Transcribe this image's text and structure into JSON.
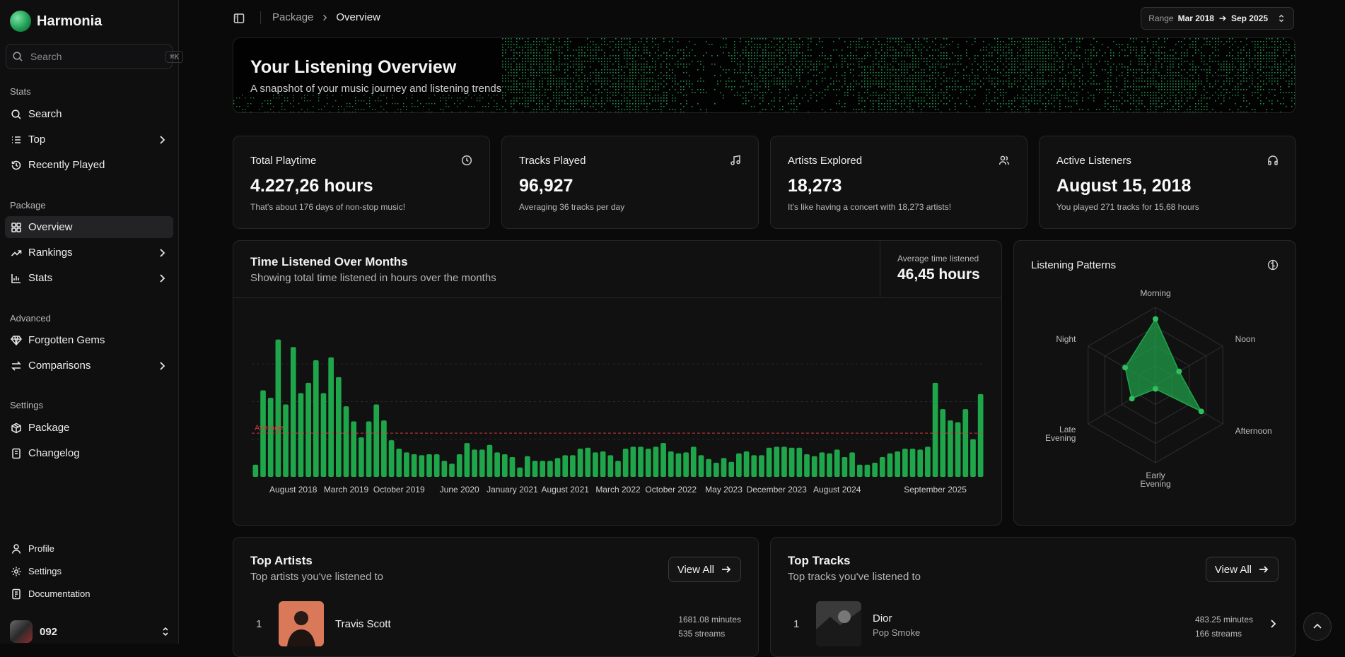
{
  "app": {
    "name": "Harmonia"
  },
  "search": {
    "placeholder": "Search",
    "shortcut": "⌘K"
  },
  "sidebar": {
    "sections": [
      {
        "label": "Stats",
        "items": [
          {
            "label": "Search",
            "icon": "search-icon"
          },
          {
            "label": "Top",
            "icon": "list-icon",
            "chevron": true
          },
          {
            "label": "Recently Played",
            "icon": "history-icon"
          }
        ]
      },
      {
        "label": "Package",
        "items": [
          {
            "label": "Overview",
            "icon": "layout-grid-icon",
            "active": true
          },
          {
            "label": "Rankings",
            "icon": "trending-up-icon",
            "chevron": true
          },
          {
            "label": "Stats",
            "icon": "bar-chart-icon",
            "chevron": true
          }
        ]
      },
      {
        "label": "Advanced",
        "items": [
          {
            "label": "Forgotten Gems",
            "icon": "gem-icon"
          },
          {
            "label": "Comparisons",
            "icon": "arrows-swap-icon",
            "chevron": true
          }
        ]
      },
      {
        "label": "Settings",
        "items": [
          {
            "label": "Package",
            "icon": "package-icon"
          },
          {
            "label": "Changelog",
            "icon": "book-icon"
          }
        ]
      }
    ],
    "footer": [
      {
        "label": "Profile",
        "icon": "user-icon"
      },
      {
        "label": "Settings",
        "icon": "gear-icon"
      },
      {
        "label": "Documentation",
        "icon": "document-icon"
      }
    ],
    "user": {
      "name": "092"
    }
  },
  "breadcrumb": {
    "parent": "Package",
    "current": "Overview"
  },
  "range": {
    "label": "Range",
    "start": "Mar 2018",
    "end": "Sep 2025"
  },
  "hero": {
    "title": "Your Listening Overview",
    "subtitle": "A snapshot of your music journey and listening trends"
  },
  "stats": [
    {
      "title": "Total Playtime",
      "value": "4.227,26 hours",
      "sub": "That's about 176 days of non-stop music!",
      "icon": "clock-icon"
    },
    {
      "title": "Tracks Played",
      "value": "96,927",
      "sub": "Averaging 36 tracks per day",
      "icon": "music-note-icon"
    },
    {
      "title": "Artists Explored",
      "value": "18,273",
      "sub": "It's like having a concert with 18,273 artists!",
      "icon": "users-icon"
    },
    {
      "title": "Active Listeners",
      "value": "August 15, 2018",
      "sub": "You played 271 tracks for 15,68 hours",
      "icon": "headphones-icon"
    }
  ],
  "time_chart": {
    "title": "Time Listened Over Months",
    "subtitle": "Showing total time listened in hours over the months",
    "avg_label": "Average time listened",
    "avg_value": "46,45 hours"
  },
  "patterns": {
    "title": "Listening Patterns",
    "icon": "info-icon"
  },
  "chart_data": [
    {
      "type": "bar",
      "title": "Time Listened Over Months",
      "ylabel": "Hours",
      "ylim": [
        0,
        160
      ],
      "grid": true,
      "color": "#1fa64a",
      "average": {
        "label": "Average",
        "value": 46.45,
        "color": "#d63a3a"
      },
      "tick_labels": [
        "August 2018",
        "March 2019",
        "October 2019",
        "June 2020",
        "January 2021",
        "August 2021",
        "March 2022",
        "October 2022",
        "May 2023",
        "December 2023",
        "August 2024",
        "September 2025"
      ],
      "tick_indices": [
        5,
        12,
        19,
        27,
        34,
        41,
        48,
        55,
        62,
        69,
        77,
        90
      ],
      "values": [
        13,
        92,
        84,
        146,
        77,
        138,
        89,
        100,
        124,
        89,
        127,
        106,
        75,
        59,
        42,
        59,
        77,
        60,
        39,
        30,
        26,
        24,
        23,
        24,
        24,
        17,
        14,
        24,
        36,
        29,
        29,
        34,
        26,
        24,
        21,
        10,
        22,
        17,
        17,
        17,
        20,
        23,
        23,
        30,
        31,
        26,
        27,
        23,
        17,
        30,
        32,
        32,
        30,
        32,
        36,
        27,
        25,
        26,
        32,
        23,
        19,
        15,
        20,
        16,
        25,
        27,
        23,
        23,
        31,
        32,
        32,
        31,
        31,
        24,
        22,
        26,
        25,
        29,
        21,
        26,
        13,
        13,
        15,
        21,
        25,
        27,
        30,
        30,
        29,
        32,
        100,
        72,
        60,
        58,
        72,
        40,
        88
      ]
    },
    {
      "type": "radar",
      "title": "Listening Patterns",
      "categories": [
        "Morning",
        "Noon",
        "Afternoon",
        "Early Evening",
        "Late Evening",
        "Night"
      ],
      "values": [
        0.85,
        0.35,
        0.68,
        0.05,
        0.35,
        0.45
      ],
      "rmax": 1,
      "rings": 4,
      "color": "#1fa64a"
    }
  ],
  "top_artists": {
    "title": "Top Artists",
    "subtitle": "Top artists you've listened to",
    "view_all": "View All",
    "items": [
      {
        "rank": "1",
        "name": "Travis Scott",
        "minutes": "1681.08 minutes",
        "streams": "535 streams"
      }
    ]
  },
  "top_tracks": {
    "title": "Top Tracks",
    "subtitle": "Top tracks you've listened to",
    "view_all": "View All",
    "items": [
      {
        "rank": "1",
        "name": "Dior",
        "artist": "Pop Smoke",
        "minutes": "483.25 minutes",
        "streams": "166 streams"
      }
    ]
  }
}
